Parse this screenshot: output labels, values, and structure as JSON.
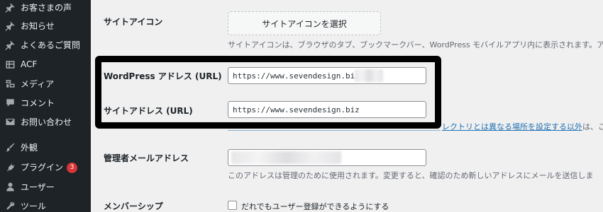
{
  "sidebar": {
    "items": [
      {
        "label": "お客さまの声",
        "icon": "pin-icon"
      },
      {
        "label": "お知らせ",
        "icon": "pin-icon"
      },
      {
        "label": "よくあるご質問",
        "icon": "pin-icon"
      },
      {
        "label": "ACF",
        "icon": "grid-icon"
      },
      {
        "label": "メディア",
        "icon": "media-icon"
      },
      {
        "label": "コメント",
        "icon": "comment-icon"
      },
      {
        "label": "お問い合わせ",
        "icon": "mail-icon"
      },
      {
        "label": "外観",
        "icon": "brush-icon"
      },
      {
        "label": "プラグイン",
        "icon": "plugin-icon",
        "badge": "3"
      },
      {
        "label": "ユーザー",
        "icon": "user-icon"
      },
      {
        "label": "ツール",
        "icon": "wrench-icon"
      }
    ]
  },
  "settings": {
    "site_icon": {
      "label": "サイトアイコン",
      "button": "サイトアイコンを選択",
      "description": "サイトアイコンは、ブラウザのタブ、ブックマークバー、WordPress モバイルアプリ内に表示されます。ア"
    },
    "wordpress_address": {
      "label": "WordPress アドレス (URL)",
      "value": "https://www.sevendesign.biz/"
    },
    "site_address": {
      "label": "サイトアドレス (URL)",
      "value": "https://www.sevendesign.biz",
      "description_visible": "レクトリとは異なる場所を設定する以外",
      "description_link": "設定する以外",
      "description_tail": "は、こ"
    },
    "admin_email": {
      "label": "管理者メールアドレス",
      "description": "このアドレスは管理のために使用されます。変更すると、確認のため新しいアドレスにメールを送信しま"
    },
    "membership": {
      "label": "メンバーシップ",
      "checkbox_label": "だれでもユーザー登録ができるようにする"
    }
  },
  "colors": {
    "sidebar_bg": "#1d2327",
    "page_bg": "#f0f0f1",
    "link": "#2271b1",
    "badge": "#d63638"
  }
}
